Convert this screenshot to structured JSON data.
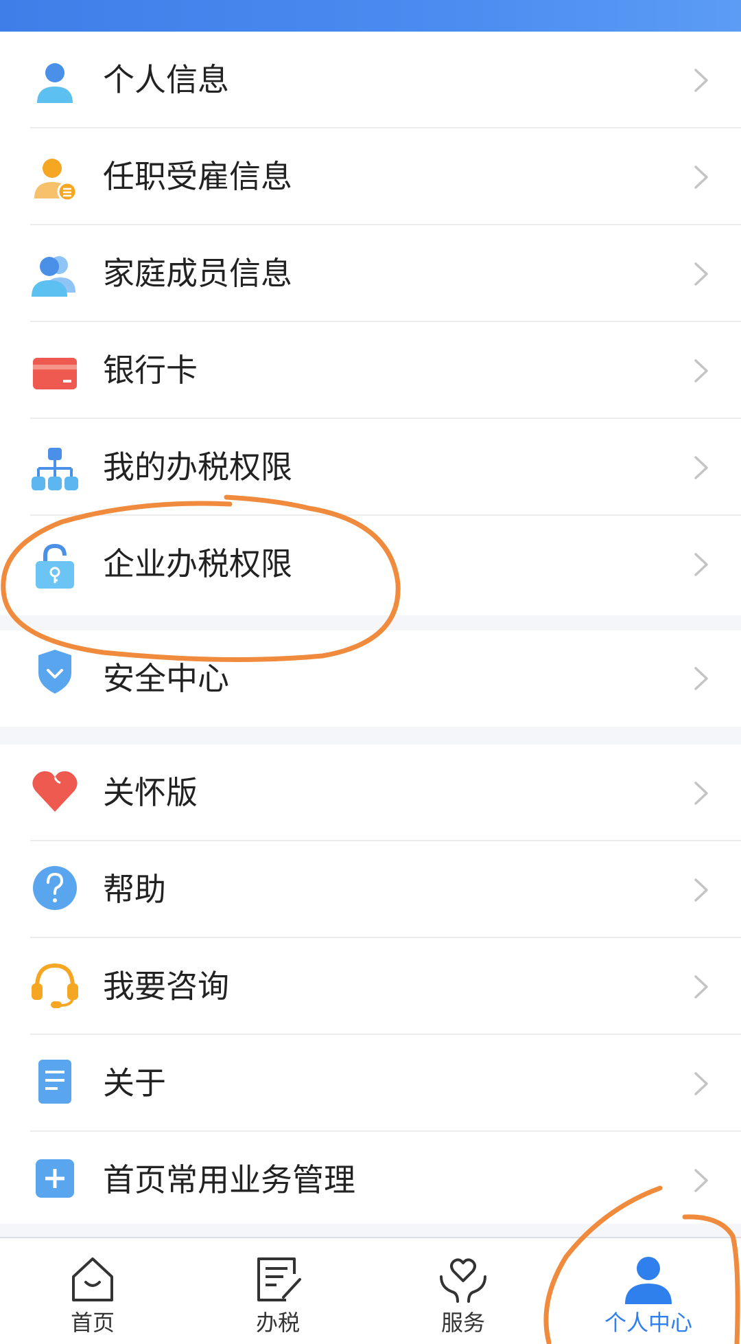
{
  "menu_sections": [
    {
      "items": [
        {
          "label": "个人信息",
          "icon": "user-icon"
        },
        {
          "label": "任职受雇信息",
          "icon": "employment-icon"
        },
        {
          "label": "家庭成员信息",
          "icon": "family-icon"
        },
        {
          "label": "银行卡",
          "icon": "bank-card-icon"
        },
        {
          "label": "我的办税权限",
          "icon": "org-chart-icon"
        },
        {
          "label": "企业办税权限",
          "icon": "lock-icon"
        }
      ]
    },
    {
      "items": [
        {
          "label": "安全中心",
          "icon": "shield-icon"
        }
      ]
    },
    {
      "items": [
        {
          "label": "关怀版",
          "icon": "heart-icon"
        },
        {
          "label": "帮助",
          "icon": "help-icon"
        },
        {
          "label": "我要咨询",
          "icon": "headset-icon"
        },
        {
          "label": "关于",
          "icon": "document-icon"
        },
        {
          "label": "首页常用业务管理",
          "icon": "plus-icon"
        }
      ]
    }
  ],
  "tab_bar": {
    "active_index": 3,
    "items": [
      {
        "label": "首页",
        "icon": "home-icon"
      },
      {
        "label": "办税",
        "icon": "edit-document-icon"
      },
      {
        "label": "服务",
        "icon": "service-heart-icon"
      },
      {
        "label": "个人中心",
        "icon": "person-icon"
      }
    ]
  },
  "colors": {
    "header_blue": "#3f7ee8",
    "tab_active": "#2f80ed",
    "annotation_orange": "#f08a3c",
    "page_background": "#f4f6fa"
  }
}
